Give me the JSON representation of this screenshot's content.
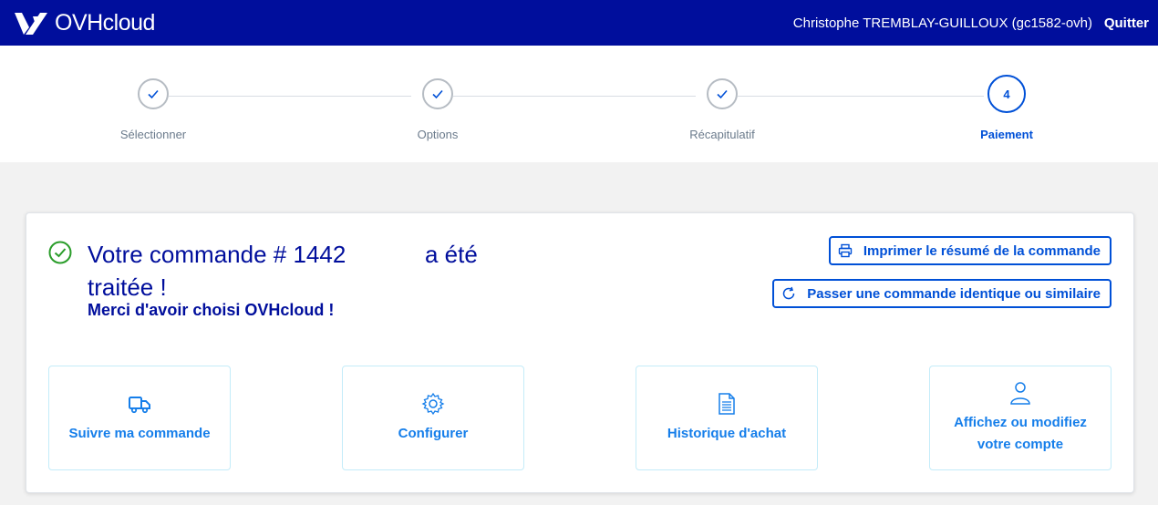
{
  "header": {
    "brand": "OVHcloud",
    "user_name": "Christophe TREMBLAY-GUILLOUX (gc1582-ovh)",
    "logout_label": "Quitter"
  },
  "stepper": {
    "steps": [
      {
        "label": "Sélectionner",
        "state": "done",
        "icon": "check-icon"
      },
      {
        "label": "Options",
        "state": "done",
        "icon": "check-icon"
      },
      {
        "label": "Récapitulatif",
        "state": "done",
        "icon": "check-icon"
      },
      {
        "label": "Paiement",
        "state": "active",
        "number": "4"
      }
    ]
  },
  "confirmation": {
    "title": "Votre commande # 1442            a été traitée !",
    "subtitle": "Merci d'avoir choisi OVHcloud !",
    "icon": "check-circle-icon",
    "print_label": "Imprimer le résumé de la commande",
    "repeat_label": "Passer une commande identique ou similaire"
  },
  "tiles": [
    {
      "label": "Suivre ma commande",
      "icon": "truck-icon"
    },
    {
      "label": "Configurer",
      "icon": "gear-icon"
    },
    {
      "label": "Historique d'achat",
      "icon": "document-icon"
    },
    {
      "label": "Affichez ou modifiez votre compte",
      "icon": "user-icon"
    }
  ],
  "colors": {
    "header_bg": "#000e9c",
    "primary": "#0050d7",
    "tile_text": "#157eea",
    "success": "#2a9d2a",
    "page_bg": "#f2f2f2"
  }
}
